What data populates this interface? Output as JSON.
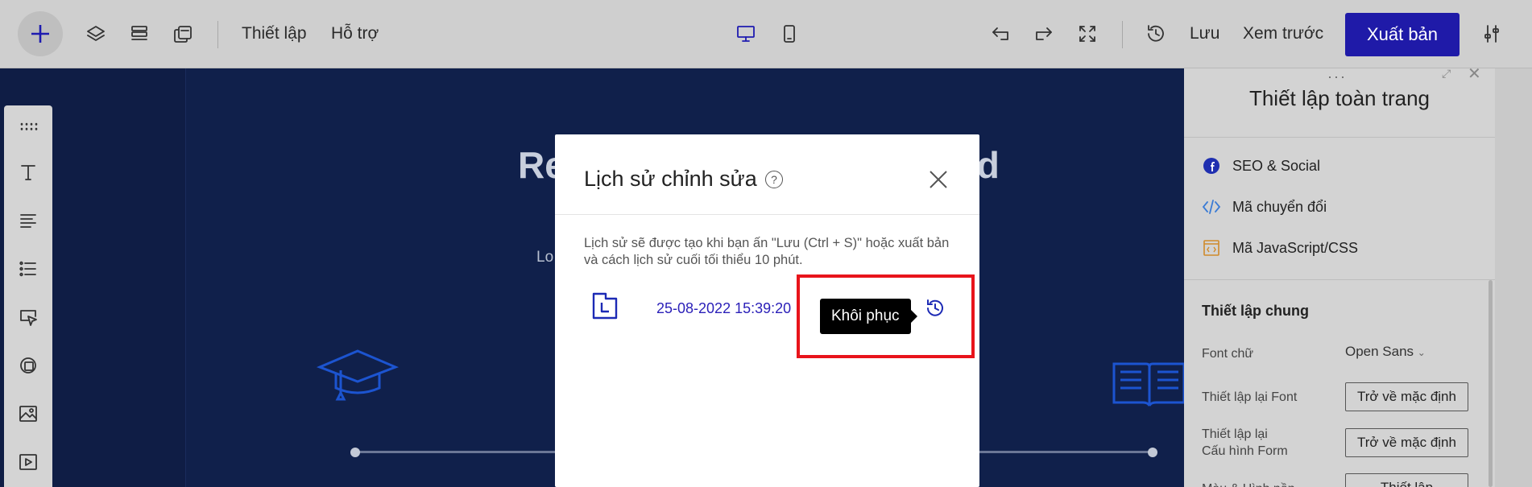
{
  "toolbar": {
    "settings_label": "Thiết lập",
    "support_label": "Hỗ trợ",
    "save_label": "Lưu",
    "preview_label": "Xem trước",
    "publish_label": "Xuất bản"
  },
  "canvas": {
    "hero_title_left": "Re",
    "hero_title_right": "ld",
    "hero_subtitle": "Lo"
  },
  "right_panel": {
    "title": "Thiết lập toàn trang",
    "links": [
      {
        "label": "SEO & Social",
        "icon": "facebook-icon"
      },
      {
        "label": "Mã chuyển đổi",
        "icon": "code-icon"
      },
      {
        "label": "Mã JavaScript/CSS",
        "icon": "code-file-icon"
      }
    ],
    "section_title": "Thiết lập chung",
    "font_label": "Font chữ",
    "font_value": "Open Sans",
    "reset_font_label": "Thiết lập lại Font",
    "reset_form_label_line1": "Thiết lập lại",
    "reset_form_label_line2": "Cấu hình Form",
    "reset_button_label": "Trở về mặc định",
    "bg_label": "Màu & Hình nền",
    "bg_button_label": "Thiết lập"
  },
  "modal": {
    "title": "Lịch sử chỉnh sửa",
    "help_glyph": "?",
    "description": "Lịch sử sẽ được tạo khi bạn ấn \"Lưu (Ctrl + S)\" hoặc xuất bản và cách lịch sử cuối tối thiểu 10 phút.",
    "history_items": [
      {
        "date": "25-08-2022 15:39:20"
      }
    ],
    "tooltip": "Khôi phục"
  },
  "colors": {
    "accent": "#1f1aa8",
    "highlight": "#e8141b",
    "canvas_bg": "#0f1d45"
  }
}
